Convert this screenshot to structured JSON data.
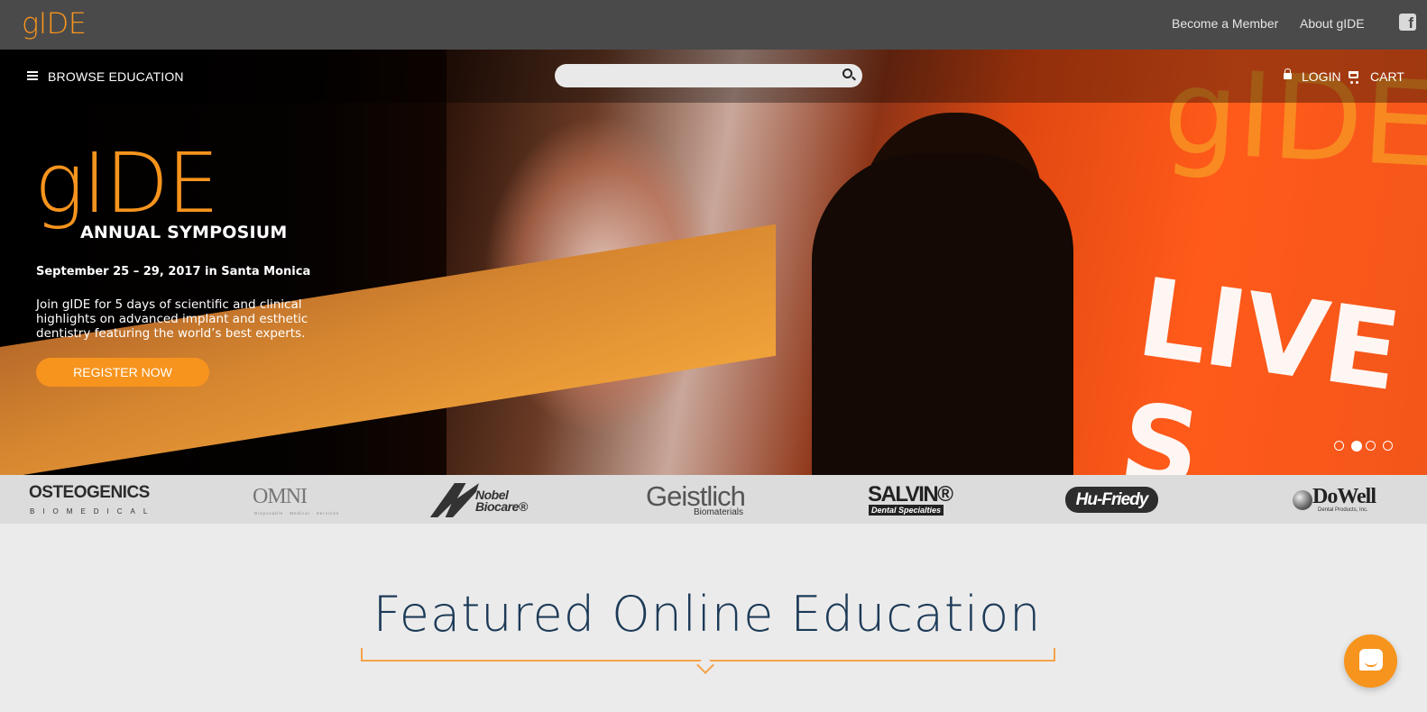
{
  "header": {
    "logo": "gIDE",
    "links": [
      "Become a Member",
      "About gIDE"
    ],
    "social_icon": "facebook-icon"
  },
  "nav": {
    "browse_label": "BROWSE EDUCATION",
    "search_placeholder": "",
    "search_value": "",
    "login_label": "LOGIN",
    "cart_label": "CART"
  },
  "hero": {
    "logo_text": "gIDE",
    "subtitle": "ANNUAL SYMPOSIUM",
    "date_line": "September 25 – 29, 2017 in Santa Monica",
    "description": "Join gIDE for 5 days of scientific and clinical highlights on advanced implant and esthetic dentistry featuring the world’s best experts.",
    "cta_label": "REGISTER NOW",
    "photo_text_live": "LIVE S",
    "photo_text_logo": "gIDE",
    "carousel": {
      "count": 4,
      "active_index": 1
    }
  },
  "sponsors": [
    {
      "name": "OSTEOGENICS",
      "sub": "BIOMEDICAL"
    },
    {
      "name": "OMNI",
      "sub": "Disposable · Medical · Services"
    },
    {
      "name": "Nobel Biocare",
      "line1": "Nobel",
      "line2": "Biocare®"
    },
    {
      "name": "Geistlich",
      "sub": "Biomaterials"
    },
    {
      "name": "SALVIN®",
      "sub": "Dental Specialties"
    },
    {
      "name": "Hu-Friedy"
    },
    {
      "name": "DoWell",
      "sub": "Dental Products, Inc."
    }
  ],
  "featured": {
    "title": "Featured Online Education"
  },
  "colors": {
    "accent": "#f7941d",
    "topbar": "#4a4a4a",
    "title": "#1c3a57"
  }
}
